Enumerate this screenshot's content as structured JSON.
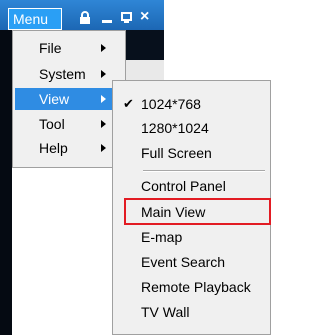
{
  "toolbar": {
    "menu_label": "Menu",
    "icons": [
      "lock-icon",
      "minimize-icon",
      "restore-icon",
      "close-icon"
    ],
    "close_glyph": "×"
  },
  "main_menu": {
    "items": [
      {
        "label": "File"
      },
      {
        "label": "System"
      },
      {
        "label": "View",
        "selected": true
      },
      {
        "label": "Tool"
      },
      {
        "label": "Help"
      }
    ]
  },
  "view_submenu": {
    "check_glyph": "✔",
    "resolution_items": [
      {
        "label": "1024*768",
        "checked": true
      },
      {
        "label": "1280*1024"
      },
      {
        "label": "Full Screen"
      }
    ],
    "window_items": [
      {
        "label": "Control Panel"
      },
      {
        "label": "Main View",
        "highlighted": true
      },
      {
        "label": "E-map"
      },
      {
        "label": "Event Search"
      },
      {
        "label": "Remote Playback"
      },
      {
        "label": "TV Wall"
      }
    ]
  },
  "colors": {
    "titlebar": "#1c67b4",
    "selection": "#2f8ce3",
    "highlight_box": "#e21b23"
  }
}
